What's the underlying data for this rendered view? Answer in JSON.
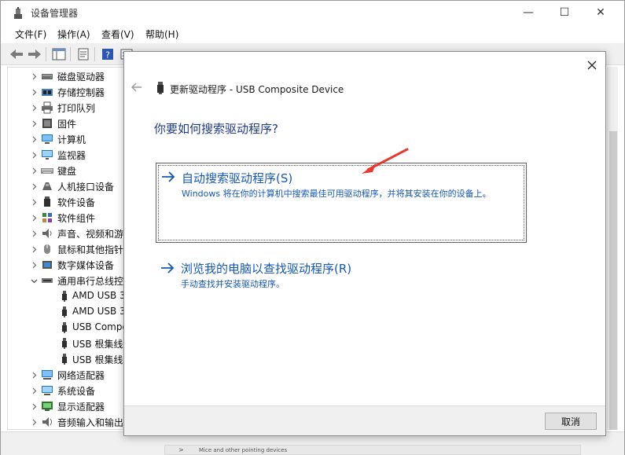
{
  "window": {
    "title": "设备管理器",
    "controls": {
      "minimize": "—",
      "maximize": "☐",
      "close": "✕"
    }
  },
  "menu": {
    "items": [
      {
        "label": "文件(F)"
      },
      {
        "label": "操作(A)"
      },
      {
        "label": "查看(V)"
      },
      {
        "label": "帮助(H)"
      }
    ]
  },
  "tree": {
    "nodes": [
      {
        "label": "磁盘驱动器",
        "icon": "disk-drive-icon",
        "expanded": false,
        "level": 0
      },
      {
        "label": "存储控制器",
        "icon": "storage-controller-icon",
        "expanded": false,
        "level": 0
      },
      {
        "label": "打印队列",
        "icon": "printer-icon",
        "expanded": false,
        "level": 0
      },
      {
        "label": "固件",
        "icon": "firmware-icon",
        "expanded": false,
        "level": 0
      },
      {
        "label": "计算机",
        "icon": "computer-icon",
        "expanded": false,
        "level": 0
      },
      {
        "label": "监视器",
        "icon": "monitor-icon",
        "expanded": false,
        "level": 0
      },
      {
        "label": "键盘",
        "icon": "keyboard-icon",
        "expanded": false,
        "level": 0
      },
      {
        "label": "人机接口设备",
        "icon": "hid-icon",
        "expanded": false,
        "level": 0
      },
      {
        "label": "软件设备",
        "icon": "software-device-icon",
        "expanded": false,
        "level": 0
      },
      {
        "label": "软件组件",
        "icon": "software-component-icon",
        "expanded": false,
        "level": 0
      },
      {
        "label": "声音、视频和游",
        "icon": "sound-icon",
        "expanded": false,
        "level": 0
      },
      {
        "label": "鼠标和其他指针",
        "icon": "mouse-icon",
        "expanded": false,
        "level": 0
      },
      {
        "label": "数字媒体设备",
        "icon": "media-device-icon",
        "expanded": false,
        "level": 0
      },
      {
        "label": "通用串行总线控",
        "icon": "usb-controller-icon",
        "expanded": true,
        "level": 0
      },
      {
        "label": "AMD USB 3",
        "icon": "usb-plug-icon",
        "level": 1
      },
      {
        "label": "AMD USB 3",
        "icon": "usb-plug-icon",
        "level": 1
      },
      {
        "label": "USB Compo",
        "icon": "usb-plug-icon",
        "level": 1
      },
      {
        "label": "USB 根集线",
        "icon": "usb-plug-icon",
        "level": 1
      },
      {
        "label": "USB 根集线",
        "icon": "usb-plug-icon",
        "level": 1
      },
      {
        "label": "网络适配器",
        "icon": "network-adapter-icon",
        "expanded": false,
        "level": 0
      },
      {
        "label": "系统设备",
        "icon": "system-device-icon",
        "expanded": false,
        "level": 0
      },
      {
        "label": "显示适配器",
        "icon": "display-adapter-icon",
        "expanded": false,
        "level": 0
      },
      {
        "label": "音频输入和输出",
        "icon": "audio-io-icon",
        "expanded": false,
        "level": 0
      }
    ]
  },
  "statusbar": {
    "text": "Mice and other pointing devices"
  },
  "dialog": {
    "title": "更新驱动程序 - USB Composite Device",
    "heading": "你要如何搜索驱动程序?",
    "options": [
      {
        "title": "自动搜索驱动程序(S)",
        "description": "Windows 将在你的计算机中搜索最佳可用驱动程序，并将其安装在你的设备上。"
      },
      {
        "title": "浏览我的电脑以查找驱动程序(R)",
        "description": "手动查找并安装驱动程序。"
      }
    ],
    "cancel_label": "取消"
  },
  "colors": {
    "link_blue": "#1558b8",
    "heading_blue": "#1f3a8a",
    "annotation_red": "#e8382f"
  }
}
